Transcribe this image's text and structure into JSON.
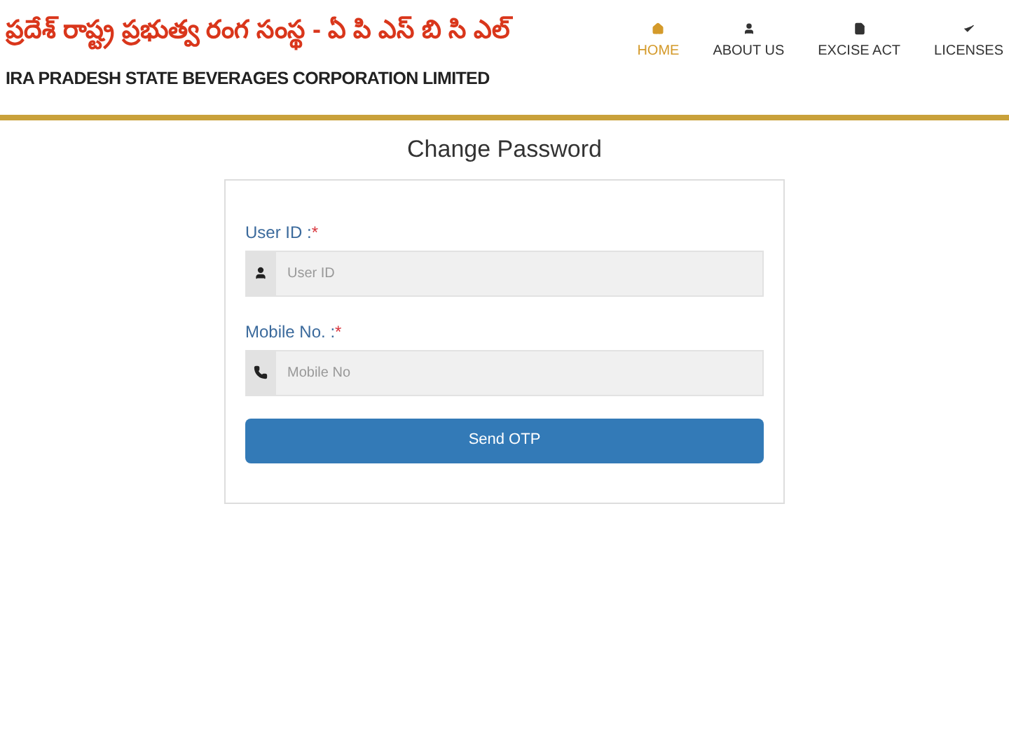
{
  "header": {
    "title_telugu": "ప్రదేశ్ రాష్ట్ర ప్రభుత్వ రంగ సంస్థ - ఏ పి ఎస్ బి సి ఎల్",
    "title_english": "IRA PRADESH STATE BEVERAGES CORPORATION LIMITED"
  },
  "nav": [
    {
      "label": "HOME",
      "kind": "home",
      "selected": true
    },
    {
      "label": "ABOUT US",
      "kind": "user",
      "selected": false
    },
    {
      "label": "EXCISE ACT",
      "kind": "file",
      "selected": false
    },
    {
      "label": "LICENSES",
      "kind": "check",
      "selected": false
    }
  ],
  "form": {
    "title": "Change Password",
    "fields": [
      {
        "label": "User ID :",
        "required_mark": "*",
        "kind": "user",
        "placeholder": "User ID"
      },
      {
        "label": "Mobile No. :",
        "required_mark": "*",
        "kind": "phone",
        "placeholder": "Mobile No"
      }
    ],
    "button": "Send OTP"
  }
}
